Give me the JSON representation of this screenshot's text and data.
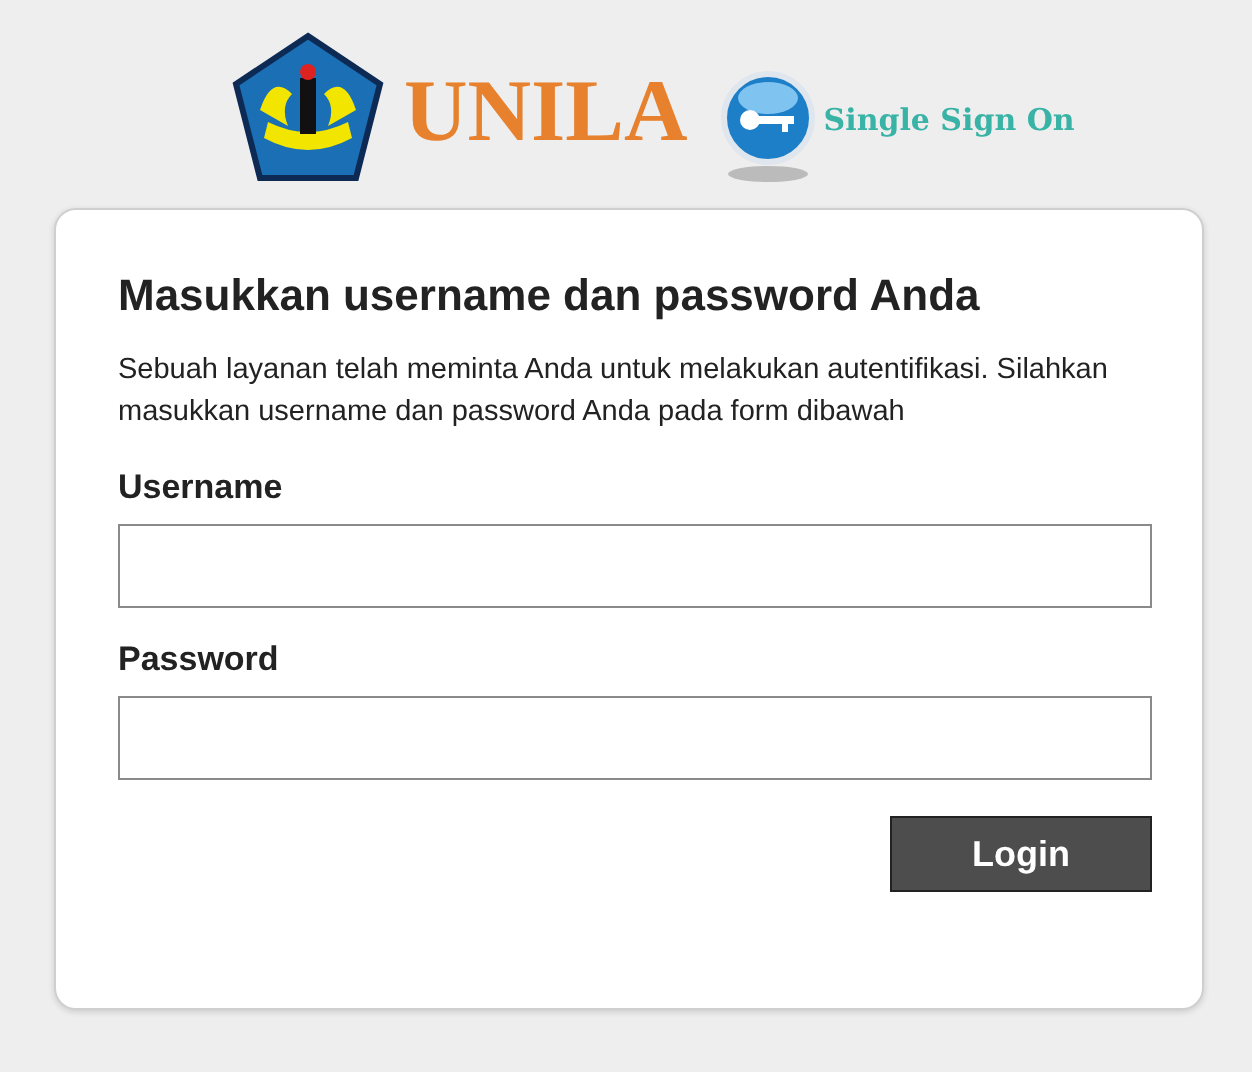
{
  "header": {
    "brand": "UNILA",
    "tagline": "Single Sign On"
  },
  "form": {
    "title": "Masukkan username dan password Anda",
    "description": "Sebuah layanan telah meminta Anda untuk melakukan autentifikasi. Silahkan masukkan username dan password Anda pada form dibawah",
    "fields": [
      {
        "label": "Username"
      },
      {
        "label": "Password"
      }
    ],
    "submit": "Login"
  }
}
